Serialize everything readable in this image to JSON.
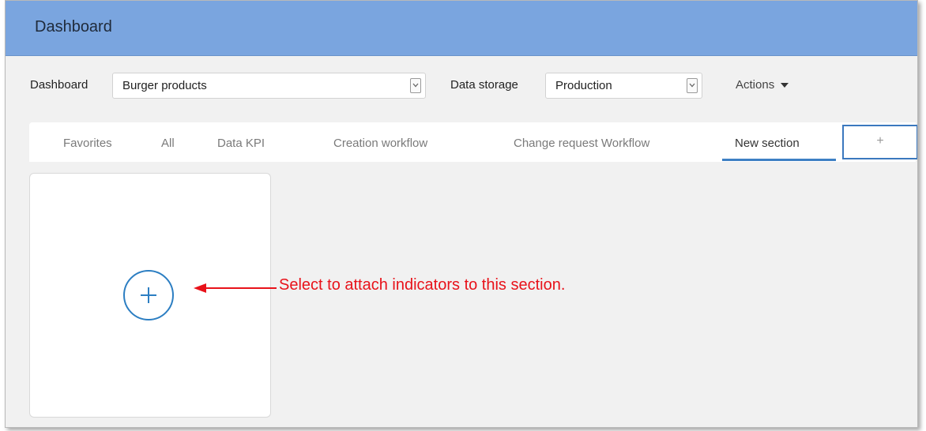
{
  "header": {
    "title": "Dashboard"
  },
  "filters": {
    "dashboard_label": "Dashboard",
    "dashboard_value": "Burger products",
    "storage_label": "Data storage",
    "storage_value": "Production",
    "actions_label": "Actions"
  },
  "tabs": [
    {
      "label": "Favorites",
      "active": false
    },
    {
      "label": "All",
      "active": false
    },
    {
      "label": "Data KPI",
      "active": false
    },
    {
      "label": "Creation workflow",
      "active": false
    },
    {
      "label": "Change request Workflow",
      "active": false
    },
    {
      "label": "New section",
      "active": true
    }
  ],
  "add_tab_label": "+",
  "annotation": {
    "text": "Select to attach indicators to this section.",
    "color": "#e8121a"
  },
  "colors": {
    "header": "#7aa5df",
    "accent": "#3e80c4"
  },
  "icons": {
    "add_indicator": "plus-circle-icon",
    "dropdown": "chevron-down-icon",
    "actions_caret": "caret-down-icon"
  }
}
